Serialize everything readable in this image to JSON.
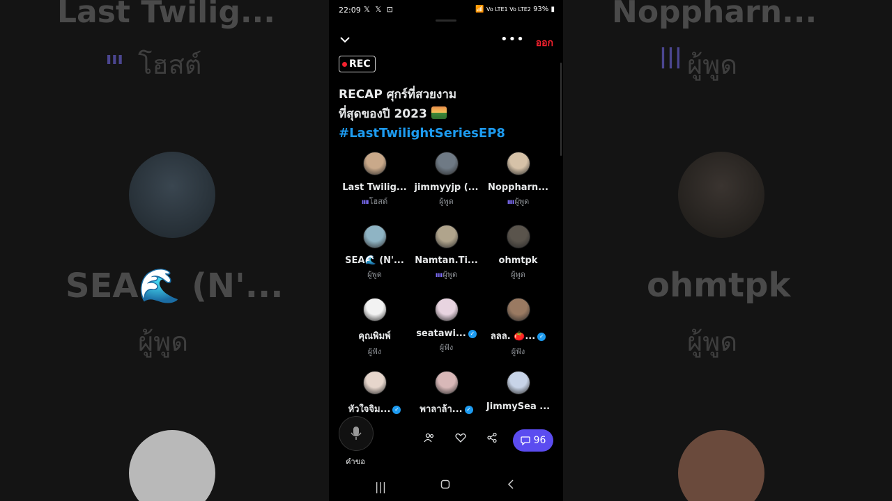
{
  "status_bar": {
    "time": "22:09",
    "notif_icons": "𝕏 𝕏 ⊡",
    "signal_text": "Vo LTE1 Vo LTE2",
    "battery": "93%"
  },
  "header": {
    "leave_label": "ออก",
    "rec_label": "REC"
  },
  "space": {
    "title_line1": "RECAP ศุกร์ที่สวยงาม",
    "title_line2": "ที่สุดของปี 2023",
    "hashtag": "#LastTwilightSeriesEP8"
  },
  "participants": [
    {
      "name": "Last Twilig...",
      "role": "โฮสต์",
      "speaking": true,
      "verified": false,
      "color": "#c9a98a"
    },
    {
      "name": "jimmyyjp (...",
      "role": "ผู้พูด",
      "speaking": false,
      "verified": false,
      "color": "#6f7a85"
    },
    {
      "name": "Noppharn...",
      "role": "ผู้พูด",
      "speaking": true,
      "verified": false,
      "color": "#d6c2a8"
    },
    {
      "name": "SEA🌊 (N'...",
      "role": "ผู้พูด",
      "speaking": false,
      "verified": false,
      "color": "#8fb4c4"
    },
    {
      "name": "Namtan.Ti...",
      "role": "ผู้พูด",
      "speaking": true,
      "verified": false,
      "color": "#b0a48c"
    },
    {
      "name": "ohmtpk",
      "role": "ผู้พูด",
      "speaking": false,
      "verified": false,
      "color": "#5a544c"
    },
    {
      "name": "คุณพิมพ์",
      "role": "ผู้ฟัง",
      "speaking": false,
      "verified": false,
      "color": "#f2f2f2"
    },
    {
      "name": "seatawi...",
      "role": "ผู้ฟัง",
      "speaking": false,
      "verified": true,
      "color": "#e8d4e0"
    },
    {
      "name": "ลลล. 🍅...",
      "role": "ผู้ฟัง",
      "speaking": false,
      "verified": true,
      "color": "#9a7a62"
    },
    {
      "name": "หัวใจจิม...",
      "role": "",
      "speaking": false,
      "verified": true,
      "color": "#e6d6cc"
    },
    {
      "name": "พาลาล้า...",
      "role": "",
      "speaking": false,
      "verified": true,
      "color": "#d8b8b8"
    },
    {
      "name": "JimmySea ...",
      "role": "",
      "speaking": false,
      "verified": false,
      "color": "#c8d4e8"
    }
  ],
  "bottom": {
    "request_label": "คำขอ",
    "comment_count": "96"
  },
  "background": {
    "left_name": "Last Twilig...",
    "left_role": "โฮสต์",
    "left_name2": "SEA🌊 (N'...",
    "left_role2": "ผู้พูด",
    "right_name": "Noppharn...",
    "right_role": "ผู้พูด",
    "right_name2": "ohmtpk",
    "right_role2": "ผู้พูด"
  }
}
